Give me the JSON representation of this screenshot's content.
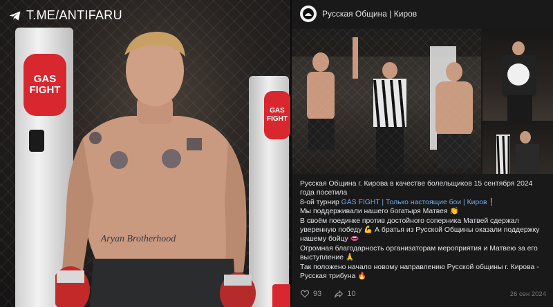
{
  "watermark": {
    "icon": "telegram-icon",
    "text": "T.ME/ANTIFARU"
  },
  "left_photo": {
    "banner_text_line1": "GAS",
    "banner_text_line2": "FIGHT",
    "side_banner_line1": "GAS",
    "side_banner_line2": "FIGHT",
    "tattoo_text": "Aryan Brotherhood"
  },
  "post": {
    "community_name": "Русская Община | Киров",
    "line1": "Русская Община г. Кирова в качестве болельщиков 15 сентября 2024 года посетила",
    "line2_prefix": "8-ой турнир ",
    "line2_link": "GAS FIGHT | Только настоящие бои | Киров",
    "line2_emoji": "❗",
    "line3": "Мы поддерживали нашего богатыря Матвея 👏",
    "line4": "В своём поединке против достойного соперника Матвей сдержал уверенную победу 💪 А братья из Русской Общины оказали поддержку нашему бойцу 👄",
    "line5": "Огромная благодарность организаторам мероприятия и Матвею за его выступление 🙏",
    "line6": "Так положено начало новому направлению Русской общины г. Кирова - Русская трибуна 🔥",
    "likes": "93",
    "shares": "10",
    "date": "26 сен 2024"
  },
  "colors": {
    "link": "#71aaeb",
    "post_bg": "#191919",
    "text": "#e1e3e6",
    "brand_red": "#d8272f"
  }
}
